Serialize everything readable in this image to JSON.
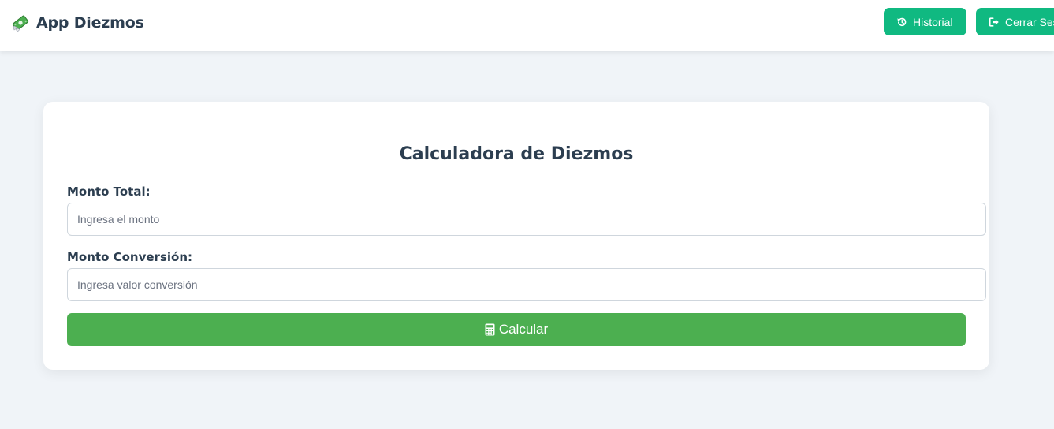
{
  "header": {
    "brand_icon": "money-with-wings-icon",
    "title": "App Diezmos",
    "buttons": {
      "history": {
        "label": "Historial",
        "icon": "history-icon"
      },
      "logout": {
        "label": "Cerrar Sesión",
        "icon": "sign-out-icon"
      }
    }
  },
  "calculator": {
    "title": "Calculadora de Diezmos",
    "total": {
      "label": "Monto Total:",
      "placeholder": "Ingresa el monto",
      "value": ""
    },
    "conversion": {
      "label": "Monto Conversión:",
      "placeholder": "Ingresa valor conversión",
      "value": ""
    },
    "submit": {
      "label": "Calcular",
      "icon": "calculator-icon"
    }
  },
  "colors": {
    "background": "#f0f4f8",
    "header_button": "#10b981",
    "calculate_button": "#4caf50",
    "text": "#2c3e50"
  }
}
